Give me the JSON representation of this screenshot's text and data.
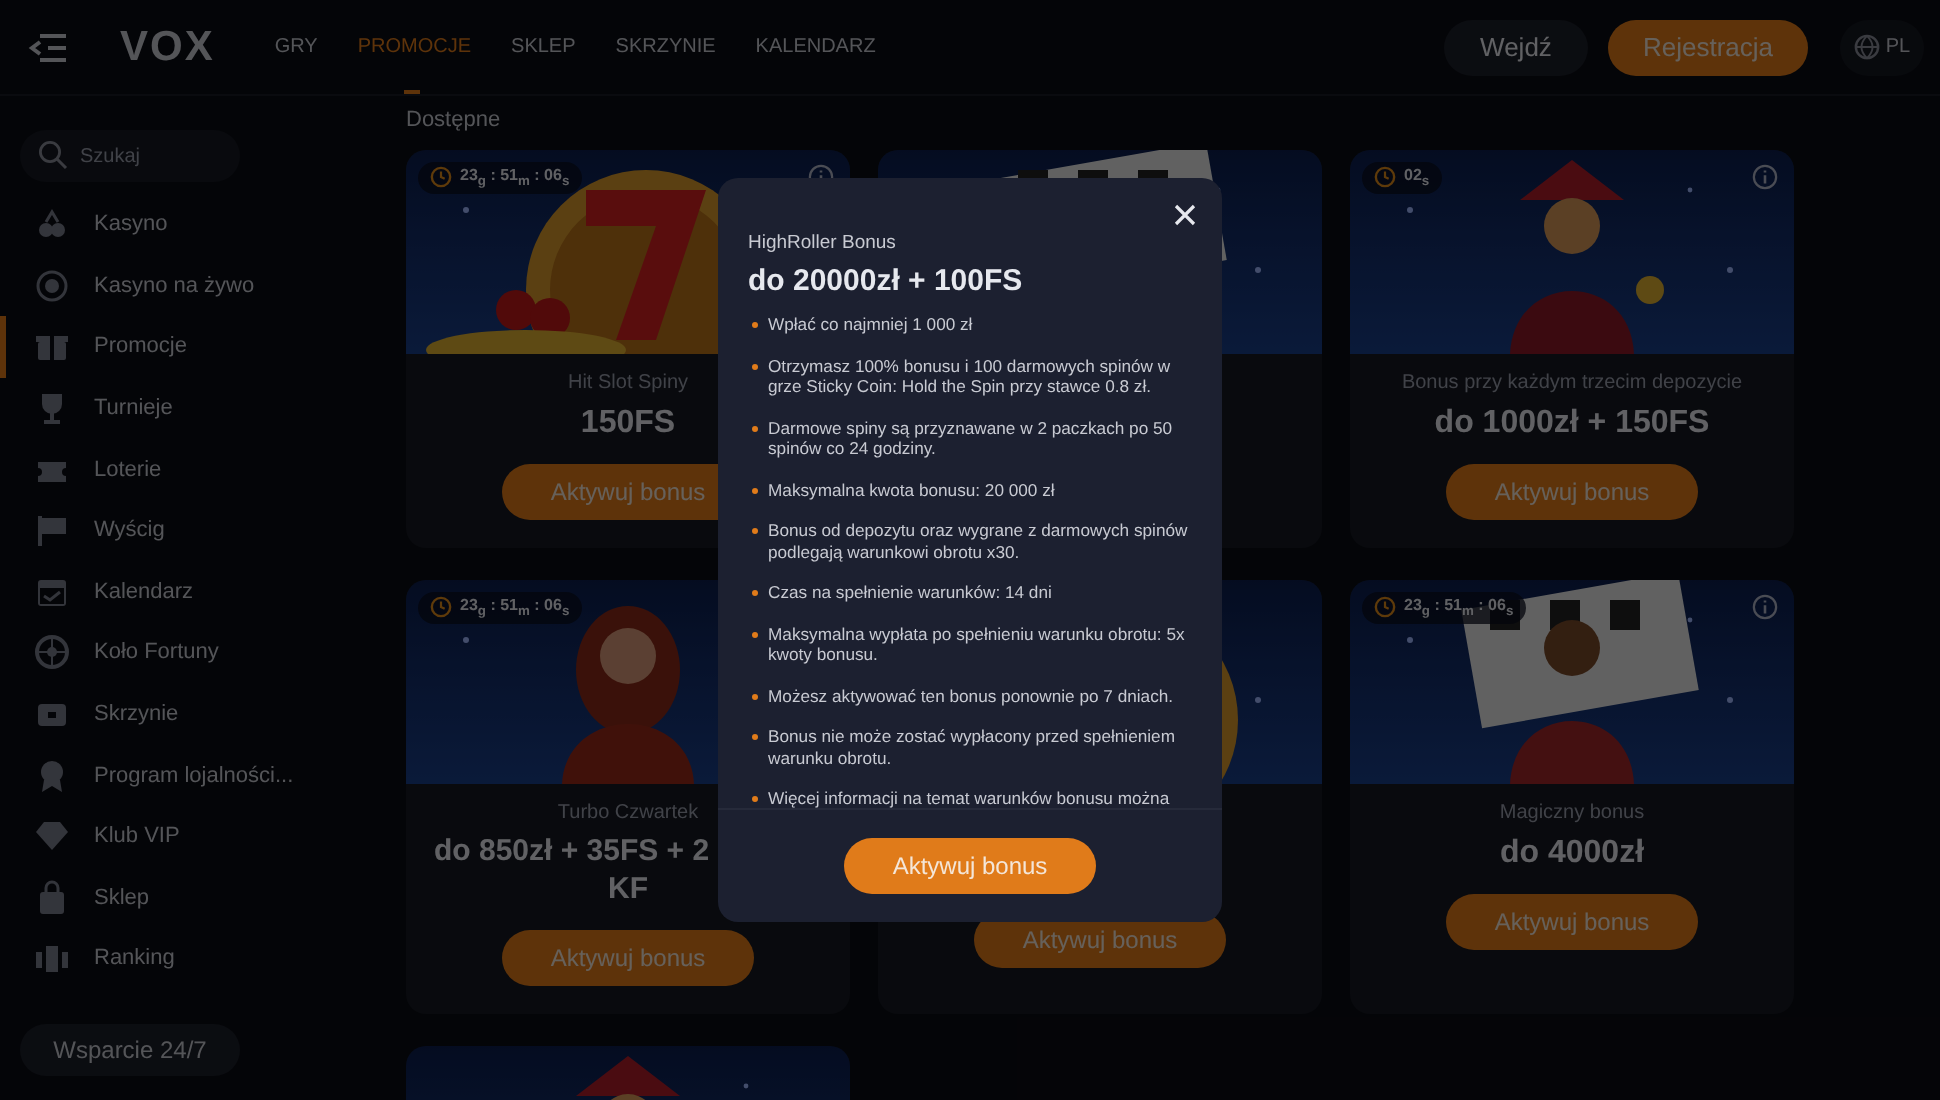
{
  "header": {
    "logo": "VOX",
    "nav": [
      {
        "label": "GRY",
        "selected": false
      },
      {
        "label": "PROMOCJE",
        "selected": true
      },
      {
        "label": "SKLEP",
        "selected": false
      },
      {
        "label": "SKRZYNIE",
        "selected": false
      },
      {
        "label": "KALENDARZ",
        "selected": false
      }
    ],
    "login": "Wejdź",
    "register": "Rejestracja",
    "language": "PL"
  },
  "sidebar": {
    "search": {
      "placeholder": "Szukaj"
    },
    "items": [
      {
        "label": "Kasyno",
        "selected": false
      },
      {
        "label": "Kasyno na żywo",
        "selected": false
      },
      {
        "label": "Promocje",
        "selected": true
      },
      {
        "label": "Turnieje",
        "selected": false
      },
      {
        "label": "Loterie",
        "selected": false
      },
      {
        "label": "Wyścig",
        "selected": false
      },
      {
        "label": "Kalendarz",
        "selected": false
      },
      {
        "label": "Koło Fortuny",
        "selected": false
      },
      {
        "label": "Skrzynie",
        "selected": false
      },
      {
        "label": "Program lojalności...",
        "selected": false
      },
      {
        "label": "Klub VIP",
        "selected": false
      },
      {
        "label": "Sklep",
        "selected": false
      },
      {
        "label": "Ranking",
        "selected": false
      }
    ],
    "support": "Wsparcie 24/7"
  },
  "section_title": "Dostępne",
  "cards": [
    {
      "kind": "offer",
      "info": true,
      "timer": "23$_{g}$ : 51$_{m}$ : 06$_{s}$",
      "title": "Hit Slot Spiny",
      "amount": [
        "150FS"
      ],
      "button": "Aktywuj bonus"
    },
    {
      "kind": "covered"
    },
    {
      "kind": "offer",
      "info": true,
      "timer": "02$_{s}$",
      "title": "Bonus przy każdym trzecim depozycie",
      "amount": [
        "do 1000zł + 150FS"
      ],
      "button": "Aktywuj bonus"
    },
    {
      "kind": "offer",
      "info": false,
      "timer": "23$_{g}$ : 51$_{m}$ : 06$_{s}$",
      "title": "Turbo Czwartek",
      "amount": [
        "do 850zł + 35FS + 2",
        "KF"
      ],
      "button": "Aktywuj bonus"
    },
    {
      "kind": "covered",
      "button": "Aktywuj bonus"
    },
    {
      "kind": "offer",
      "info": true,
      "timer": "23$_{g}$ : 51$_{m}$ : 06$_{s}$",
      "title": "Magiczny bonus",
      "amount": [
        "do 4000zł"
      ],
      "button": "Aktywuj bonus"
    },
    {
      "kind": "picture"
    }
  ],
  "modal": {
    "subtitle": "HighRoller Bonus",
    "title": "do 20000zł + 100FS",
    "terms": [
      "Wpłać co najmniej 1 000 zł",
      "Otrzymasz 100% bonusu i 100 darmowych spinów w grze Sticky Coin: Hold the Spin przy stawce 0.8 zł.",
      "Darmowe spiny są przyznawane w 2 paczkach po 50 spinów co 24 godziny.",
      "Maksymalna kwota bonusu: 20 000 zł",
      "Bonus od depozytu oraz wygrane z darmowych spinów podlegają warunkowi obrotu x30.",
      "Czas na spełnienie warunków: 14 dni",
      "Maksymalna wypłata po spełnieniu warunku obrotu: 5x kwoty bonusu.",
      "Możesz aktywować ten bonus ponownie po 7 dniach.",
      "Bonus nie może zostać wypłacony przed spełnieniem warunku obrotu.",
      "Więcej informacji na temat warunków bonusu można"
    ],
    "button": "Aktywuj bonus"
  }
}
